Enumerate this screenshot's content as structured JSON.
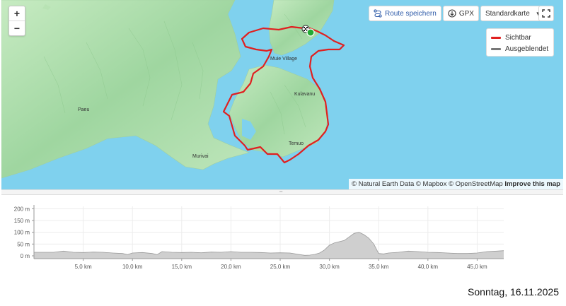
{
  "map": {
    "zoom_in": "+",
    "zoom_out": "−",
    "toolbar": {
      "save_route": "Route speichern",
      "gpx": "GPX",
      "map_style": "Standardkarte"
    },
    "legend": {
      "visible": "Sichtbar",
      "hidden": "Ausgeblendet",
      "visible_color": "#e02020",
      "hidden_color": "#777777"
    },
    "places": {
      "muie_village": "Muie Village",
      "kulavanu": "Kulavanu",
      "paeu": "Paeu",
      "temuo": "Temuo",
      "murivai": "Murivai"
    },
    "attribution": {
      "text": "© Natural Earth Data © Mapbox © OpenStreetMap",
      "improve": "Improve this map"
    },
    "colors": {
      "water": "#7fd1ee",
      "land": "#b8e3b4",
      "route": "#e02020",
      "start": "#22aa33"
    }
  },
  "chart_data": {
    "type": "area",
    "xlabel": "",
    "ylabel": "",
    "x_ticks": [
      "5,0 km",
      "10,0 km",
      "15,0 km",
      "20,0 km",
      "25,0 km",
      "30,0 km",
      "35,0 km",
      "40,0 km",
      "45,0 km"
    ],
    "y_ticks": [
      "0 m",
      "50 m",
      "100 m",
      "150 m",
      "200 m"
    ],
    "xlim": [
      0,
      47.7
    ],
    "ylim": [
      -12,
      210
    ],
    "x": [
      0,
      2,
      3,
      4,
      5,
      6,
      7,
      8,
      9,
      9.5,
      10,
      11,
      12,
      12.5,
      13,
      14,
      15,
      16,
      17,
      18,
      19,
      20,
      21,
      22,
      23,
      24,
      25,
      26,
      27,
      27.5,
      28,
      28.5,
      29,
      29.5,
      30,
      30.5,
      31,
      31.5,
      32,
      32.5,
      33,
      33.5,
      34,
      34.5,
      35,
      35.5,
      36,
      37,
      38,
      39,
      40,
      41,
      42,
      43,
      44,
      45,
      46,
      47,
      47.7
    ],
    "y": [
      15,
      15,
      20,
      15,
      14,
      16,
      15,
      12,
      10,
      5,
      12,
      14,
      10,
      5,
      18,
      15,
      14,
      15,
      13,
      16,
      15,
      18,
      15,
      15,
      14,
      12,
      13,
      12,
      5,
      2,
      3,
      6,
      12,
      25,
      45,
      55,
      60,
      65,
      80,
      95,
      100,
      90,
      75,
      50,
      10,
      8,
      12,
      15,
      20,
      18,
      15,
      14,
      12,
      10,
      10,
      12,
      18,
      20,
      22
    ],
    "colors": {
      "fill": "#cfcfcf",
      "stroke": "#9a9a9a"
    }
  },
  "date": "Sonntag, 16.11.2025"
}
